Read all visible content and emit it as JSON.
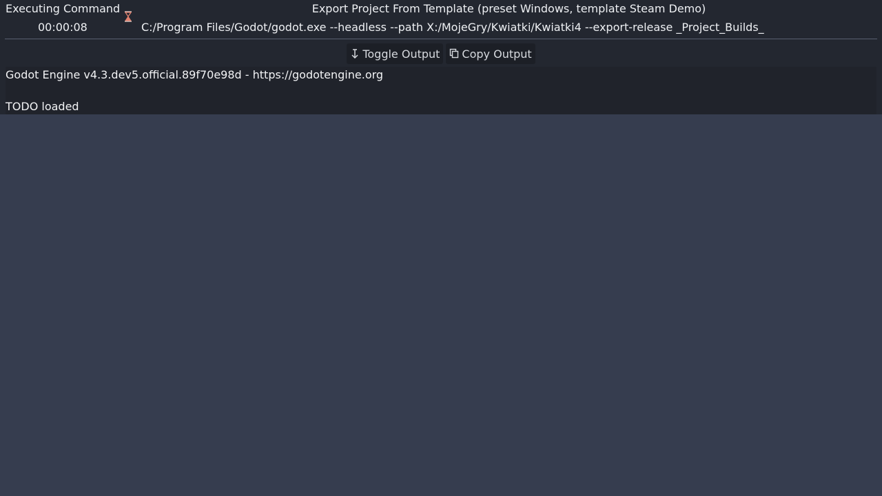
{
  "header": {
    "status": "Executing Command",
    "elapsed": "00:00:08",
    "status_icon": "hourglass-icon",
    "task_title": "Export Project From Template (preset Windows, template Steam Demo)",
    "command": "C:/Program Files/Godot/godot.exe --headless --path X:/MojeGry/Kwiatki/Kwiatki4 --export-release _Project_Builds_"
  },
  "toolbar": {
    "toggle_output_label": "Toggle Output",
    "toggle_output_icon": "arrow-down-icon",
    "copy_output_label": "Copy Output",
    "copy_output_icon": "copy-icon"
  },
  "output": {
    "lines": [
      "Godot Engine v4.3.dev5.official.89f70e98d - https://godotengine.org",
      "",
      "TODO loaded"
    ]
  },
  "colors": {
    "background": "#363d4f",
    "panel": "#232730",
    "output_bg": "#20232b",
    "button_bg": "#1c1f26",
    "hourglass_accent": "#e0806e"
  }
}
